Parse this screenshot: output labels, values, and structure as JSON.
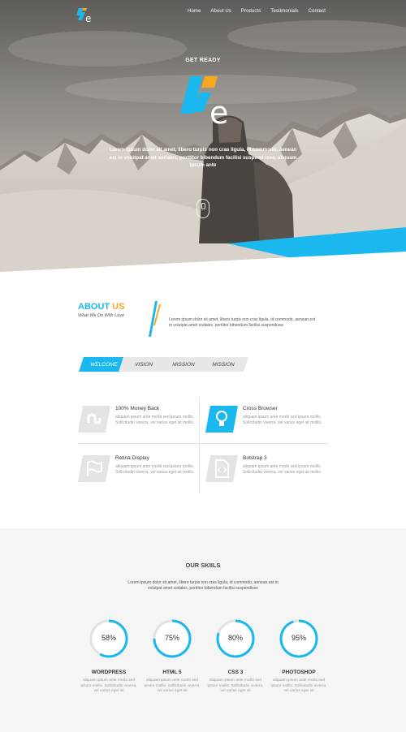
{
  "header": {
    "logo": "logo-fe-icon",
    "nav": [
      "Home",
      "About Us",
      "Products",
      "Testimonials",
      "Contact"
    ]
  },
  "hero": {
    "kicker": "GET READY",
    "text": "Lorem ipsum dolor sit amet, libero turpis non cras ligula, id commodo, aenean est in volutpat amet sodales, porttitor bibendum facilisi suspend-isse, aliquam ipsum ante"
  },
  "about": {
    "title_part1": "ABOUT",
    "title_part2": "US",
    "subtitle": "What We Do With Love",
    "text": "Lorem ipsum dolor sit amet, libero turpis non cras ligula, id commodo, aenean est in volutpat amet sodales, porttitor bibendum facilisi suspendisse"
  },
  "tabs": [
    {
      "label": "WELCOME",
      "active": true
    },
    {
      "label": "VISION",
      "active": false
    },
    {
      "label": "MISSION",
      "active": false
    },
    {
      "label": "MISSION",
      "active": false
    }
  ],
  "features": [
    {
      "title": "100% Money Back",
      "icon": "stumbleupon-icon",
      "text": "aliquam ipsum ante morbi sed ipsum mollis. Sollicitudin viverra, vel varius eget sit mollis."
    },
    {
      "title": "Cross Browser",
      "icon": "lightbulb-icon",
      "text": "aliquam ipsum ante morbi sed ipsum mollis. Sollicitudin viverra, vel varius eget sit mollis."
    },
    {
      "title": "Retina Display",
      "icon": "flag-icon",
      "text": "aliquam ipsum ante morbi sed ipsum mollis. Sollicitudin viverra, vel varius eget sit mollis."
    },
    {
      "title": "Botstrap 3",
      "icon": "code-file-icon",
      "text": "aliquam ipsum ante morbi sed ipsum mollis. Sollicitudin viverra, vel varius eget sit mollis."
    }
  ],
  "skills": {
    "title": "OUR SKIILS",
    "text": "Lorem ipsum dolor sit amet, libero turpis non cras ligula, id commodo, aenean est in volutpat amet sodales, porttitor bibendum facilisi suspendisse",
    "items": [
      {
        "name": "WORDPRESS",
        "percent": 58,
        "percent_label": "58%",
        "text": "aliquam ipsum ante morbi sed ipsum mollis. Sollicitudin viverra, vel varius eget sit"
      },
      {
        "name": "HTML 5",
        "percent": 75,
        "percent_label": "75%",
        "text": "aliquam ipsum ante morbi sed ipsum mollis. Sollicitudin viverra, vel varius eget sit"
      },
      {
        "name": "CSS 3",
        "percent": 80,
        "percent_label": "80%",
        "text": "aliquam ipsum ante morbi sed ipsum mollis. Sollicitudin viverra, vel varius eget sit"
      },
      {
        "name": "PHOTOSHOP",
        "percent": 95,
        "percent_label": "95%",
        "text": "aliquam ipsum ante morbi sed ipsum mollis. Sollicitudin viverra, vel varius eget sit"
      }
    ]
  },
  "colors": {
    "accent": "#1bb8ef",
    "orange": "#f7a823",
    "section_bg": "#f5f5f5"
  }
}
